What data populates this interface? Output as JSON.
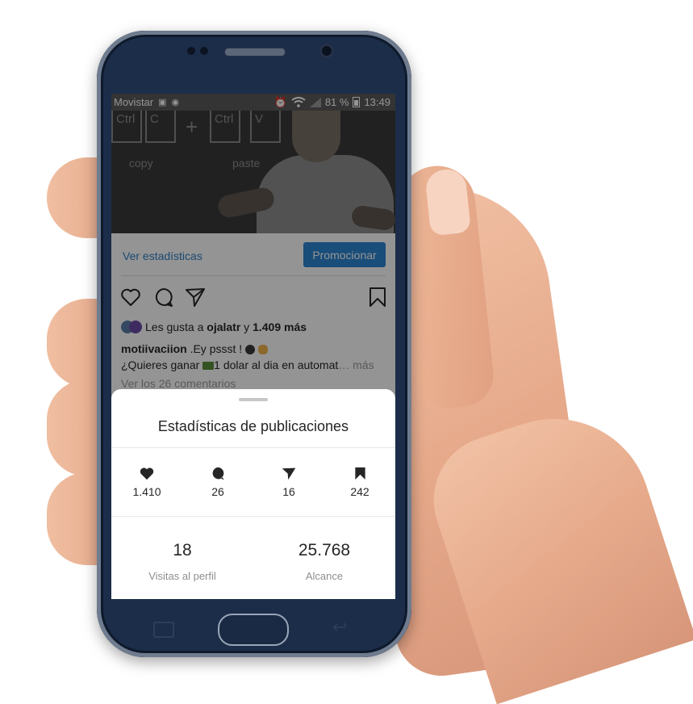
{
  "status_bar": {
    "carrier": "Movistar",
    "battery": "81 %",
    "time": "13:49"
  },
  "video": {
    "keys": [
      "Ctrl",
      "C",
      "Ctrl",
      "V"
    ],
    "plus": "+",
    "copy_label": "copy",
    "paste_label": "paste"
  },
  "post": {
    "view_stats": "Ver estadísticas",
    "promote": "Promocionar",
    "likes_prefix": "Les gusta a ",
    "likes_user": "ojalatr",
    "likes_join": " y ",
    "likes_count": "1.409 más",
    "caption_user": "motiivaciion",
    "caption_text": " .Ey pssst ! ",
    "caption_line2_a": "¿Quieres ganar ",
    "caption_line2_b": "1 dolar  al dia en automat",
    "caption_more": "… más",
    "comments": "Ver los 26 comentarios"
  },
  "sheet": {
    "title": "Estadísticas de publicaciones",
    "metrics": [
      {
        "icon": "heart-icon",
        "value": "1.410"
      },
      {
        "icon": "comment-icon",
        "value": "26"
      },
      {
        "icon": "send-icon",
        "value": "16"
      },
      {
        "icon": "bookmark-icon",
        "value": "242"
      }
    ],
    "profile_visits": {
      "value": "18",
      "label": "Visitas al perfil"
    },
    "reach": {
      "value": "25.768",
      "label": "Alcance"
    }
  },
  "colors": {
    "link_blue": "#2f7ec4",
    "button_blue": "#2b86d3",
    "phone_body": "#1c2d49",
    "text_dark": "#262626",
    "text_muted": "#8e8e8e"
  }
}
